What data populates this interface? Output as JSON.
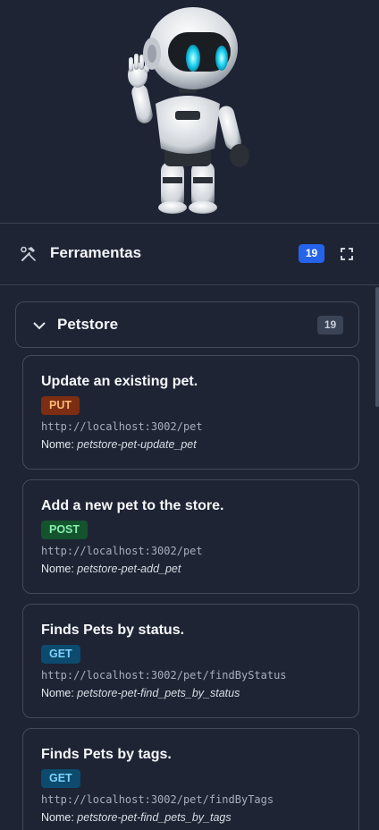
{
  "header": {
    "title": "Ferramentas",
    "count": "19"
  },
  "group": {
    "name": "Petstore",
    "count": "19"
  },
  "tools": [
    {
      "title": "Update an existing pet.",
      "method": "PUT",
      "url": "http://localhost:3002/pet",
      "nome_label": "Nome: ",
      "nome": "petstore-pet-update_pet"
    },
    {
      "title": "Add a new pet to the store.",
      "method": "POST",
      "url": "http://localhost:3002/pet",
      "nome_label": "Nome: ",
      "nome": "petstore-pet-add_pet"
    },
    {
      "title": "Finds Pets by status.",
      "method": "GET",
      "url": "http://localhost:3002/pet/findByStatus",
      "nome_label": "Nome: ",
      "nome": "petstore-pet-find_pets_by_status"
    },
    {
      "title": "Finds Pets by tags.",
      "method": "GET",
      "url": "http://localhost:3002/pet/findByTags",
      "nome_label": "Nome: ",
      "nome": "petstore-pet-find_pets_by_tags"
    }
  ],
  "colors": {
    "background": "#1e2434",
    "accent": "#2563eb",
    "put": "#7c2d12",
    "post": "#14532d",
    "get": "#0c4a6e"
  },
  "icons": {
    "header_icon": "hammer-wrench-icon",
    "expand_icon": "expand-icon",
    "group_toggle": "chevron-down-icon",
    "hero": "robot-mascot-illustration"
  }
}
